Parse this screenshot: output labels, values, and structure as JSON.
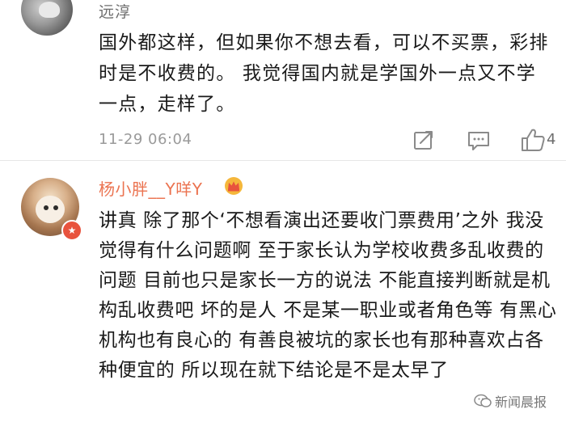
{
  "comments": [
    {
      "username": "远淳",
      "text": "国外都这样，但如果你不想去看，可以不买票，彩排时是不收费的。 我觉得国内就是学国外一点又不学一点，走样了。",
      "timestamp": "11-29 06:04",
      "likes": "4",
      "actions": {
        "share_icon": "share-icon",
        "comment_icon": "comment-icon",
        "like_icon": "thumbs-up-icon"
      }
    },
    {
      "username": "杨小胖__Y咩Y",
      "badge_icon": "crown-icon",
      "verified_icon": "verified-badge-icon",
      "text": "讲真 除了那个‘不想看演出还要收门票费用’之外 我没觉得有什么问题啊  至于家长认为学校收费多乱收费的问题 目前也只是家长一方的说法 不能直接判断就是机构乱收费吧 坏的是人 不是某一职业或者角色等 有黑心机构也有良心的 有善良被坑的家长也有那种喜欢占各种便宜的 所以现在就下结论是不是太早了"
    }
  ],
  "watermark": {
    "text": "新闻晨报",
    "icon": "wechat-icon"
  },
  "colors": {
    "username_highlight": "#eb7350",
    "username_normal": "#6d6d6d",
    "meta": "#9a9a9a",
    "text": "#1a1a1a"
  }
}
